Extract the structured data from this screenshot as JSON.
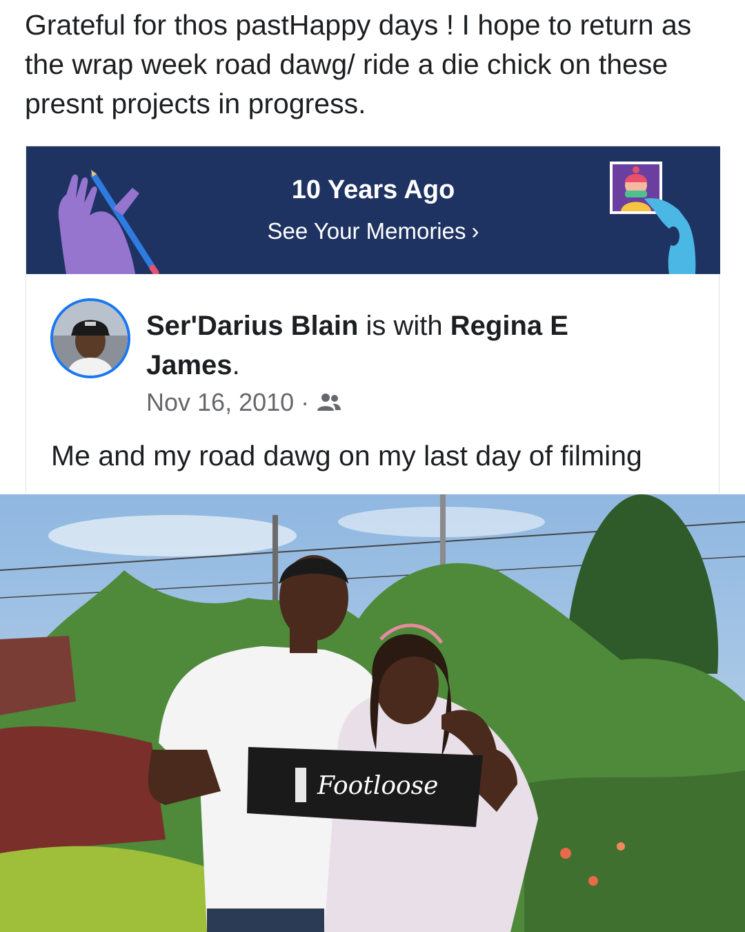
{
  "caption": "Grateful for thos pastHappy days ! I hope to return as the wrap week road dawg/ ride a die chick on these presnt projects in progress.",
  "memory_banner": {
    "title": "10 Years Ago",
    "link_label": "See Your Memories",
    "chevron": "›",
    "left_art_icon": "pencil-hand-icon",
    "right_art_icon": "photo-hand-icon",
    "background_color": "#1f3363"
  },
  "post": {
    "author": "Ser'Darius Blain",
    "with_text": " is with ",
    "tagged": "Regina E James",
    "period": ".",
    "date": "Nov 16, 2010",
    "separator": "·",
    "audience_icon": "friends-icon",
    "text": "Me and my road dawg on my last day of filming"
  },
  "photo": {
    "banner_text": "Footloose"
  },
  "colors": {
    "accent": "#1877f2",
    "text": "#1c1e21",
    "secondary_text": "#65676b"
  }
}
